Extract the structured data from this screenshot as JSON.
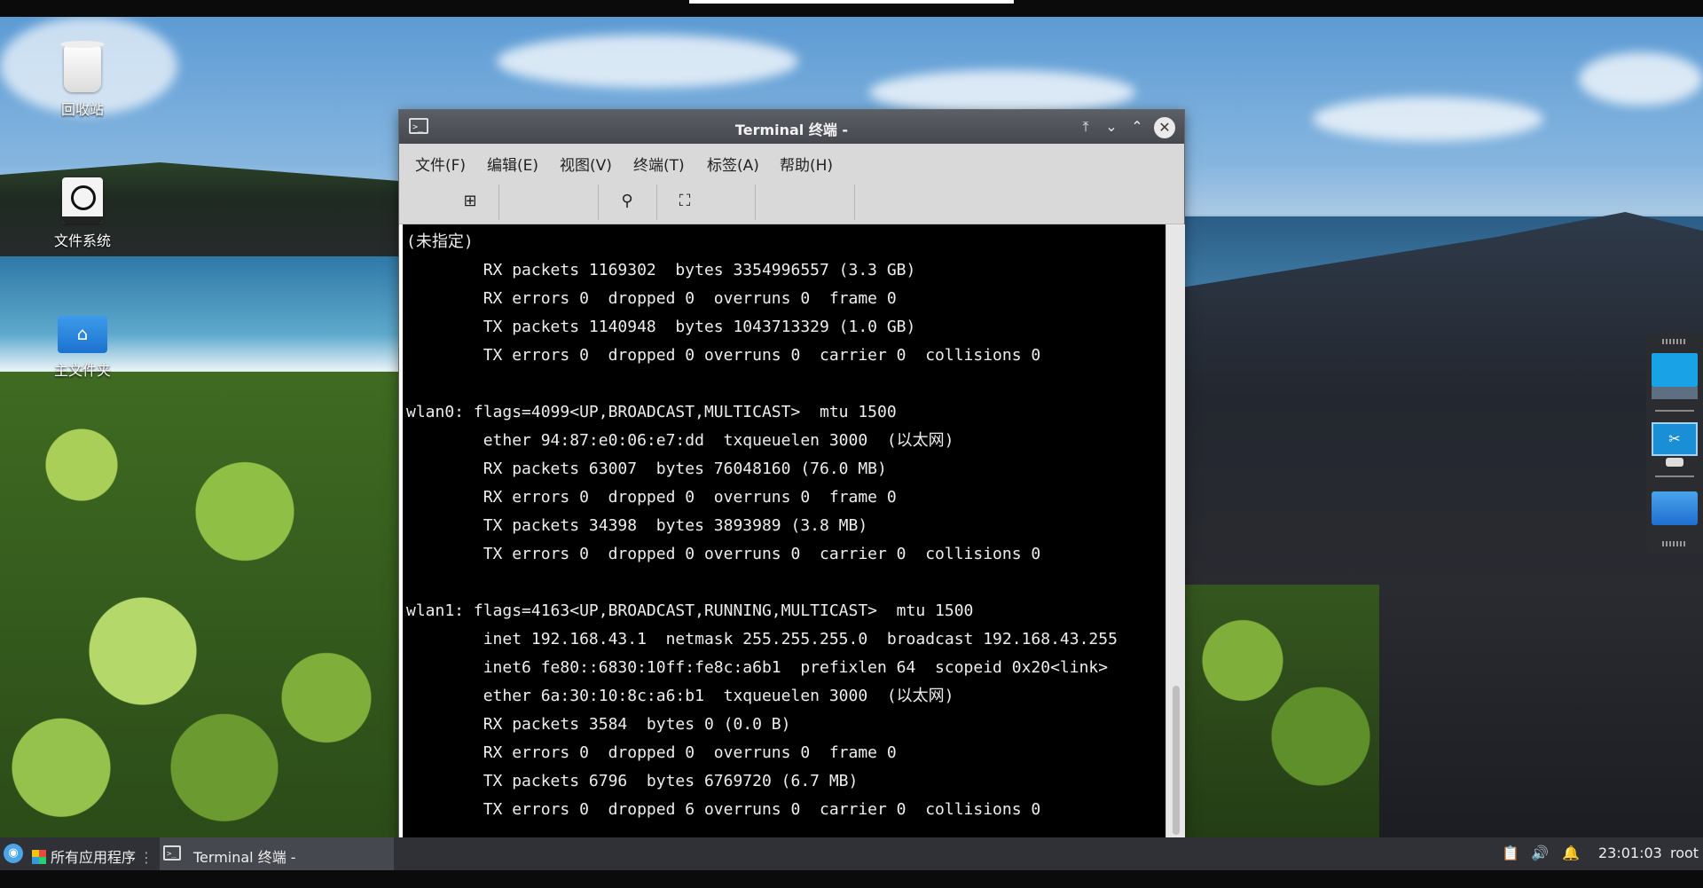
{
  "desktop": {
    "icons": [
      {
        "label": "回收站",
        "icon": "trash-icon"
      },
      {
        "label": "文件系统",
        "icon": "filesystem-icon"
      },
      {
        "label": "主文件夹",
        "icon": "home-folder-icon"
      }
    ]
  },
  "window": {
    "title": "Terminal 终端 -",
    "controls": [
      "keep-above-icon",
      "minimize-icon",
      "maximize-icon",
      "close-icon"
    ],
    "menu": [
      "文件(F)",
      "编辑(E)",
      "视图(V)",
      "终端(T)",
      "标签(A)",
      "帮助(H)"
    ],
    "toolbar": [
      "new-tab-icon",
      "search-icon",
      "fullscreen-icon"
    ]
  },
  "terminal": {
    "lines": [
      "(未指定)",
      "        RX packets 1169302  bytes 3354996557 (3.3 GB)",
      "        RX errors 0  dropped 0  overruns 0  frame 0",
      "        TX packets 1140948  bytes 1043713329 (1.0 GB)",
      "        TX errors 0  dropped 0 overruns 0  carrier 0  collisions 0",
      "",
      "wlan0: flags=4099<UP,BROADCAST,MULTICAST>  mtu 1500",
      "        ether 94:87:e0:06:e7:dd  txqueuelen 3000  (以太网)",
      "        RX packets 63007  bytes 76048160 (76.0 MB)",
      "        RX errors 0  dropped 0  overruns 0  frame 0",
      "        TX packets 34398  bytes 3893989 (3.8 MB)",
      "        TX errors 0  dropped 0 overruns 0  carrier 0  collisions 0",
      "",
      "wlan1: flags=4163<UP,BROADCAST,RUNNING,MULTICAST>  mtu 1500",
      "        inet 192.168.43.1  netmask 255.255.255.0  broadcast 192.168.43.255",
      "        inet6 fe80::6830:10ff:fe8c:a6b1  prefixlen 64  scopeid 0x20<link>",
      "        ether 6a:30:10:8c:a6:b1  txqueuelen 3000  (以太网)",
      "        RX packets 3584  bytes 0 (0.0 B)",
      "        RX errors 0  dropped 0  overruns 0  frame 0",
      "        TX packets 6796  bytes 6769720 (6.7 MB)",
      "        TX errors 0  dropped 6 overruns 0  carrier 0  collisions 0"
    ]
  },
  "taskbar": {
    "apps_label": "所有应用程序",
    "task_label": "Terminal 终端 -",
    "tray_icons": [
      "clipboard-icon",
      "volume-icon",
      "notification-bell-icon"
    ],
    "clock": "23:01:03",
    "user": "root"
  }
}
